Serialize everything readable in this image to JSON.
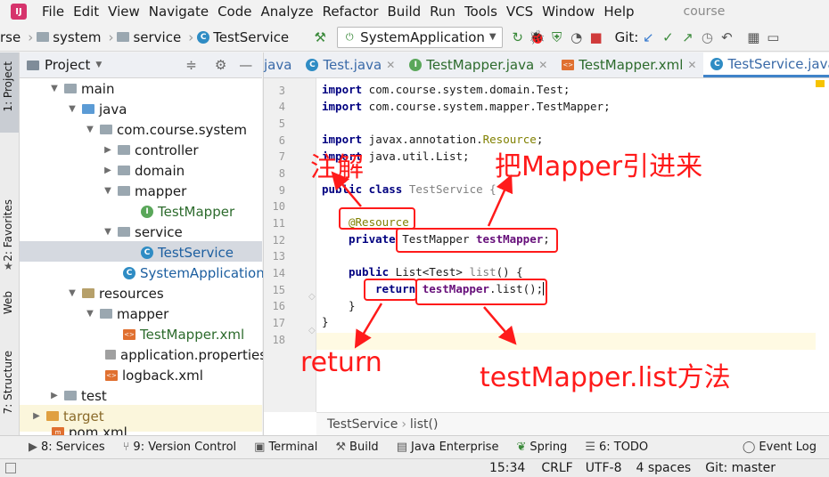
{
  "menu": {
    "items": [
      "File",
      "Edit",
      "View",
      "Navigate",
      "Code",
      "Analyze",
      "Refactor",
      "Build",
      "Run",
      "Tools",
      "VCS",
      "Window",
      "Help"
    ],
    "project_title": "course"
  },
  "nav": {
    "crumbs": [
      "rse",
      "system",
      "service",
      "TestService"
    ],
    "run_config": "SystemApplication",
    "git_label": "Git:"
  },
  "left_strip": {
    "project": "1: Project",
    "favorites": "2: Favorites",
    "web": "Web",
    "structure": "7: Structure"
  },
  "project_panel": {
    "header": "Project",
    "tree": [
      {
        "label": "main",
        "type": "folder"
      },
      {
        "label": "java",
        "type": "folder-blue"
      },
      {
        "label": "com.course.system",
        "type": "folder"
      },
      {
        "label": "controller",
        "type": "folder"
      },
      {
        "label": "domain",
        "type": "folder"
      },
      {
        "label": "mapper",
        "type": "folder"
      },
      {
        "label": "TestMapper",
        "type": "interface"
      },
      {
        "label": "service",
        "type": "folder"
      },
      {
        "label": "TestService",
        "type": "class"
      },
      {
        "label": "SystemApplication",
        "type": "class"
      },
      {
        "label": "resources",
        "type": "folder"
      },
      {
        "label": "mapper",
        "type": "folder"
      },
      {
        "label": "TestMapper.xml",
        "type": "xml"
      },
      {
        "label": "application.properties",
        "type": "props"
      },
      {
        "label": "logback.xml",
        "type": "xml"
      },
      {
        "label": "test",
        "type": "folder"
      },
      {
        "label": "target",
        "type": "folder-orange"
      },
      {
        "label": "pom.xml",
        "type": "xml"
      }
    ]
  },
  "tabs": [
    {
      "label": "java"
    },
    {
      "label": "Test.java"
    },
    {
      "label": "TestMapper.java"
    },
    {
      "label": "TestMapper.xml"
    },
    {
      "label": "TestService.java"
    }
  ],
  "code": {
    "line_numbers": [
      "3",
      "4",
      "5",
      "6",
      "7",
      "8",
      "9",
      "10",
      "11",
      "12",
      "13",
      "14",
      "15",
      "16",
      "17",
      "18"
    ],
    "lines": {
      "l3a": "import",
      "l3b": " com.course.system.domain.Test;",
      "l4a": "import",
      "l4b": " com.course.system.mapper.TestMapper;",
      "l6a": "import",
      "l6b": " javax.annotation.",
      "l6c": "Resource",
      "l6d": ";",
      "l7a": "import",
      "l7b": " java.util.List;",
      "l9a": "public class",
      "l9b": " TestService {",
      "l11": "@Resource",
      "l12a": "private",
      "l12b": " TestMapper ",
      "l12c": "testMapper",
      "l12d": ";",
      "l14a": "public",
      "l14b": " List<Test> ",
      "l14c": "list",
      "l14d": "() {",
      "l15a": "return",
      "l15b": " ",
      "l15c": "testMapper",
      "l15d": ".list();",
      "l16": "}",
      "l17": "}"
    }
  },
  "editor_breadcrumb": {
    "cls": "TestService",
    "method": "list()"
  },
  "annotations": {
    "zhujie": "注解",
    "mapper_in": "把Mapper引进来",
    "return": "return",
    "list_method": "testMapper.list方法"
  },
  "tool_windows": [
    {
      "label": "8: Services"
    },
    {
      "label": "9: Version Control"
    },
    {
      "label": "Terminal"
    },
    {
      "label": "Build"
    },
    {
      "label": "Java Enterprise"
    },
    {
      "label": "Spring"
    },
    {
      "label": "6: TODO"
    },
    {
      "label": "Event Log"
    }
  ],
  "status": {
    "position": "15:34",
    "line_sep": "CRLF",
    "encoding": "UTF-8",
    "indent": "4 spaces",
    "git": "Git: master"
  },
  "colors": {
    "accent": "#4083c9",
    "annotation_red": "#ff1a1a"
  }
}
